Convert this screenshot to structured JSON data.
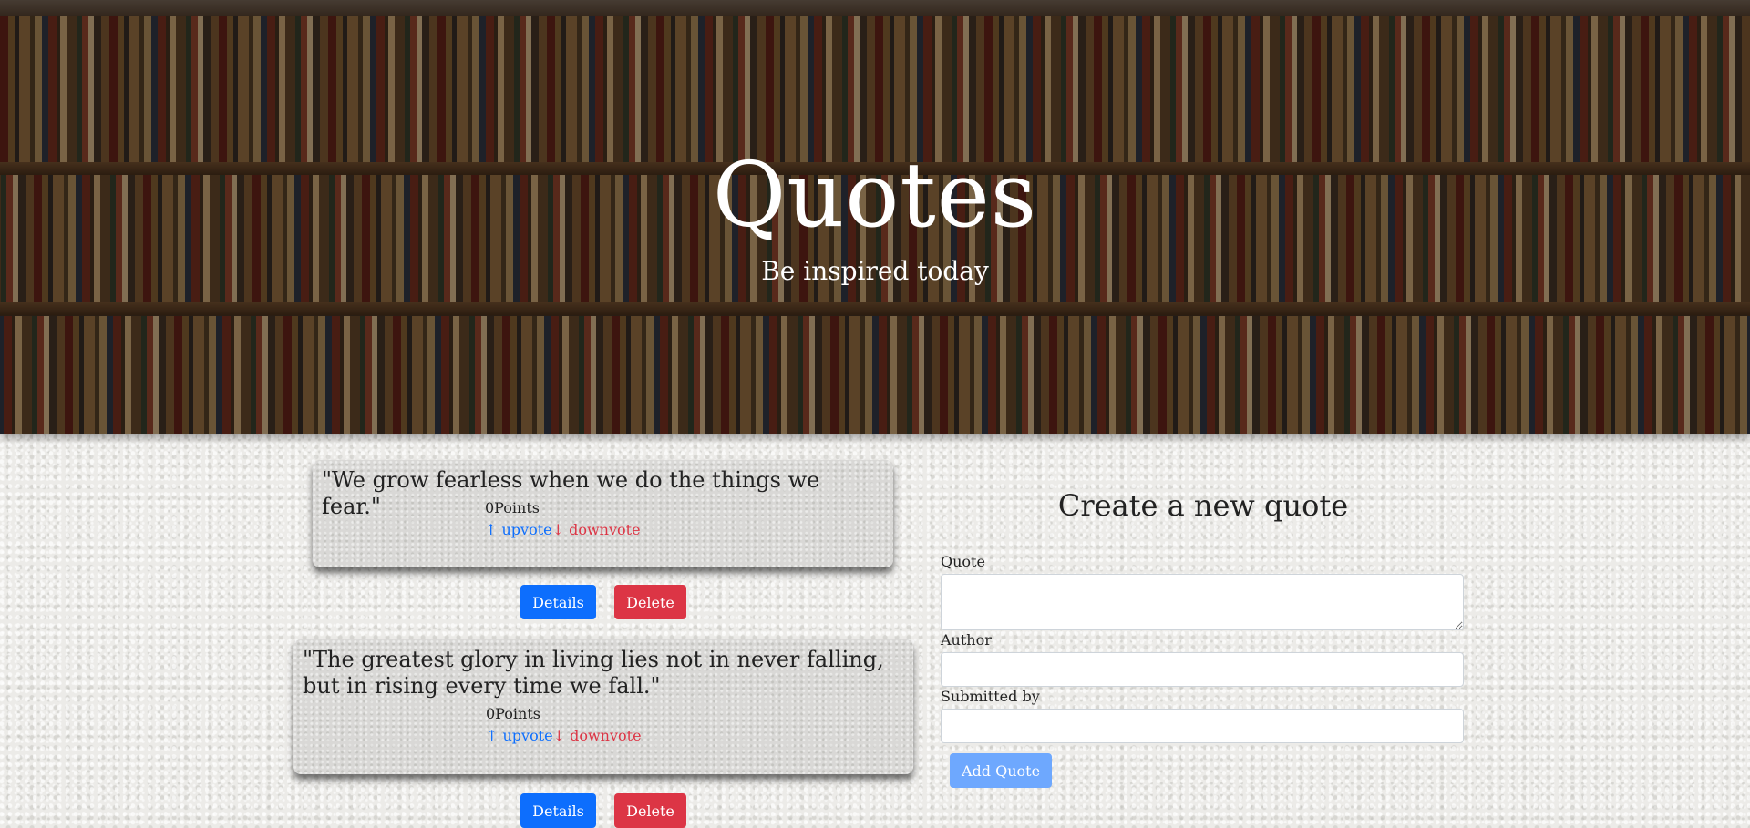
{
  "hero": {
    "title": "Quotes",
    "subtitle": "Be inspired today"
  },
  "quotes": [
    {
      "text": "\"We grow fearless when we do the things we fear.\"",
      "points": "0Points",
      "upvote": "↑ upvote",
      "downvote": "↓ downvote",
      "details_label": "Details",
      "delete_label": "Delete"
    },
    {
      "text": "\"The greatest glory in living lies not in never falling, but in rising every time we fall.\"",
      "points": "0Points",
      "upvote": "↑ upvote",
      "downvote": "↓ downvote",
      "details_label": "Details",
      "delete_label": "Delete"
    }
  ],
  "form": {
    "title": "Create a new quote",
    "quote_label": "Quote",
    "quote_value": "",
    "author_label": "Author",
    "author_value": "",
    "submitted_by_label": "Submitted by",
    "submitted_by_value": "",
    "submit_label": "Add Quote"
  },
  "colors": {
    "primary": "#0d6efd",
    "danger": "#dc3545",
    "disabled_primary": "#6ea8fe"
  }
}
